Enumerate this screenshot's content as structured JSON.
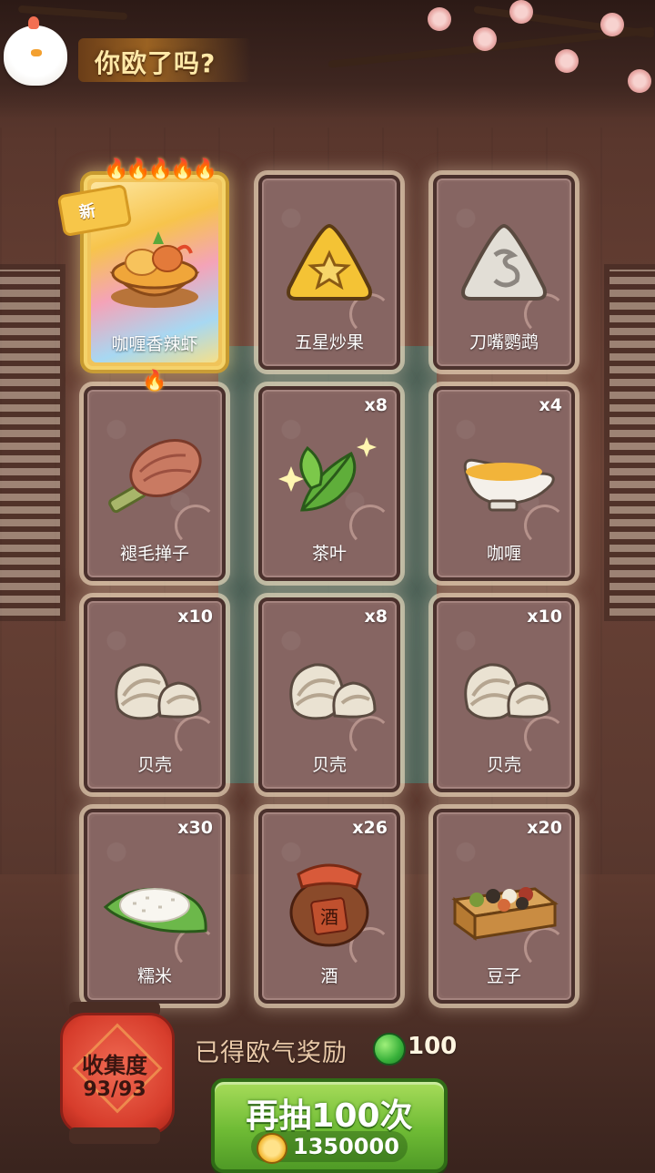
{
  "header": {
    "title": "你欧了吗?"
  },
  "cards": [
    {
      "label": "咖喱香辣虾",
      "count": "",
      "icon": "curry-shrimp-dish",
      "featured": true,
      "badge": "新",
      "flames": "🔥🔥🔥🔥🔥"
    },
    {
      "label": "五星炒果",
      "count": "",
      "icon": "star-fried-fruit"
    },
    {
      "label": "刀嘴鹦鹉",
      "count": "",
      "icon": "parrot-rice-ball"
    },
    {
      "label": "褪毛掸子",
      "count": "",
      "icon": "feather-duster",
      "flames": "🔥"
    },
    {
      "label": "茶叶",
      "count": "x8",
      "icon": "tea-leaves"
    },
    {
      "label": "咖喱",
      "count": "x4",
      "icon": "curry-gravy-boat"
    },
    {
      "label": "贝壳",
      "count": "x10",
      "icon": "clam-shell"
    },
    {
      "label": "贝壳",
      "count": "x8",
      "icon": "clam-shell"
    },
    {
      "label": "贝壳",
      "count": "x10",
      "icon": "clam-shell"
    },
    {
      "label": "糯米",
      "count": "x30",
      "icon": "glutinous-rice"
    },
    {
      "label": "酒",
      "count": "x26",
      "icon": "wine-jar",
      "jar_char": "酒"
    },
    {
      "label": "豆子",
      "count": "x20",
      "icon": "beans-box"
    }
  ],
  "collection": {
    "title": "收集度",
    "progress": "93/93"
  },
  "reward": {
    "label": "已得欧气奖励",
    "value": "100",
    "icon": "green-gem"
  },
  "draw_button": {
    "label": "再抽100次",
    "cost": "1350000",
    "icon": "gold-coin"
  },
  "colors": {
    "accent_green": "#6fbb35",
    "card_bg": "#866562",
    "lantern_red": "#d73d2c",
    "title_gold": "#ffe9a8"
  }
}
